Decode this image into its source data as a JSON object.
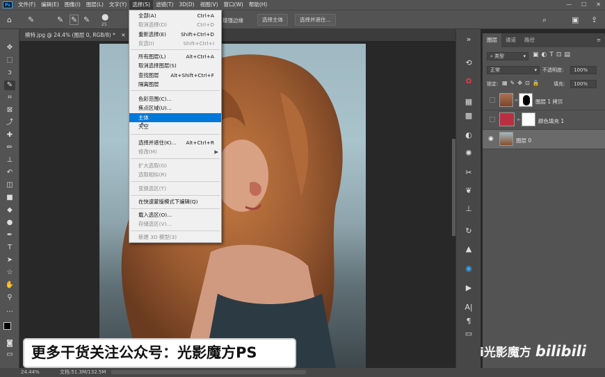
{
  "menubar": {
    "logo": "Ps",
    "items": [
      "文件(F)",
      "编辑(E)",
      "图像(I)",
      "图层(L)",
      "文字(Y)",
      "选择(S)",
      "滤镜(T)",
      "3D(D)",
      "视图(V)",
      "窗口(W)",
      "帮助(H)"
    ]
  },
  "options": {
    "brush_size": "25",
    "refine_label": "增强边缘",
    "select_subject": "选择主体",
    "select_mask": "选择并遮住..."
  },
  "document": {
    "tab_title": "模特.jpg @ 24.4% (图层 0, RGB/8) *"
  },
  "select_menu": {
    "items": [
      {
        "label": "全部(A)",
        "shortcut": "Ctrl+A",
        "disabled": false
      },
      {
        "label": "取消选择(D)",
        "shortcut": "Ctrl+D",
        "disabled": true
      },
      {
        "label": "重新选择(E)",
        "shortcut": "Shift+Ctrl+D",
        "disabled": false
      },
      {
        "label": "反选(I)",
        "shortcut": "Shift+Ctrl+I",
        "disabled": true
      },
      {
        "label": "所有图层(L)",
        "shortcut": "Alt+Ctrl+A",
        "disabled": false
      },
      {
        "label": "取消选择图层(S)",
        "shortcut": "",
        "disabled": false
      },
      {
        "label": "查找图层",
        "shortcut": "Alt+Shift+Ctrl+F",
        "disabled": false
      },
      {
        "label": "隔离图层",
        "shortcut": "",
        "disabled": false
      },
      {
        "label": "色彩范围(C)...",
        "shortcut": "",
        "disabled": false
      },
      {
        "label": "焦点区域(U)...",
        "shortcut": "",
        "disabled": false
      },
      {
        "label": "主体",
        "shortcut": "",
        "disabled": false,
        "highlighted": true
      },
      {
        "label": "天空",
        "shortcut": "",
        "disabled": false
      },
      {
        "label": "选择并遮住(K)...",
        "shortcut": "Alt+Ctrl+R",
        "disabled": false
      },
      {
        "label": "修改(M)",
        "shortcut": "",
        "disabled": true,
        "submenu": true
      },
      {
        "label": "扩大选取(G)",
        "shortcut": "",
        "disabled": true
      },
      {
        "label": "选取相似(R)",
        "shortcut": "",
        "disabled": true
      },
      {
        "label": "变换选区(T)",
        "shortcut": "",
        "disabled": true
      },
      {
        "label": "在快速蒙版模式下编辑(Q)",
        "shortcut": "",
        "disabled": false
      },
      {
        "label": "载入选区(O)...",
        "shortcut": "",
        "disabled": false
      },
      {
        "label": "存储选区(V)...",
        "shortcut": "",
        "disabled": true
      },
      {
        "label": "新建 3D 模型(3)",
        "shortcut": "",
        "disabled": true
      }
    ]
  },
  "layers_panel": {
    "tabs": [
      "图层",
      "通道",
      "路径"
    ],
    "filter_kind": "类型",
    "blend_mode": "正常",
    "opacity_label": "不透明度:",
    "opacity_value": "100%",
    "lock_label": "锁定:",
    "fill_label": "填充:",
    "fill_value": "100%",
    "layers": [
      {
        "name": "图层 1 拷贝",
        "visible": false,
        "selected": false
      },
      {
        "name": "颜色填充 1",
        "visible": false,
        "selected": false
      },
      {
        "name": "图层 0",
        "visible": true,
        "selected": true
      }
    ]
  },
  "statusbar": {
    "zoom": "24.44%",
    "doc_info": "文档:51.3M/132.5M"
  },
  "overlays": {
    "banner_text": "更多干货关注公众号：光影魔方PS",
    "watermark_text": "i光影魔方",
    "watermark_logo": "bilibili"
  },
  "colors": {
    "highlight": "#0078d7",
    "fill_layer_color": "#b83040"
  }
}
